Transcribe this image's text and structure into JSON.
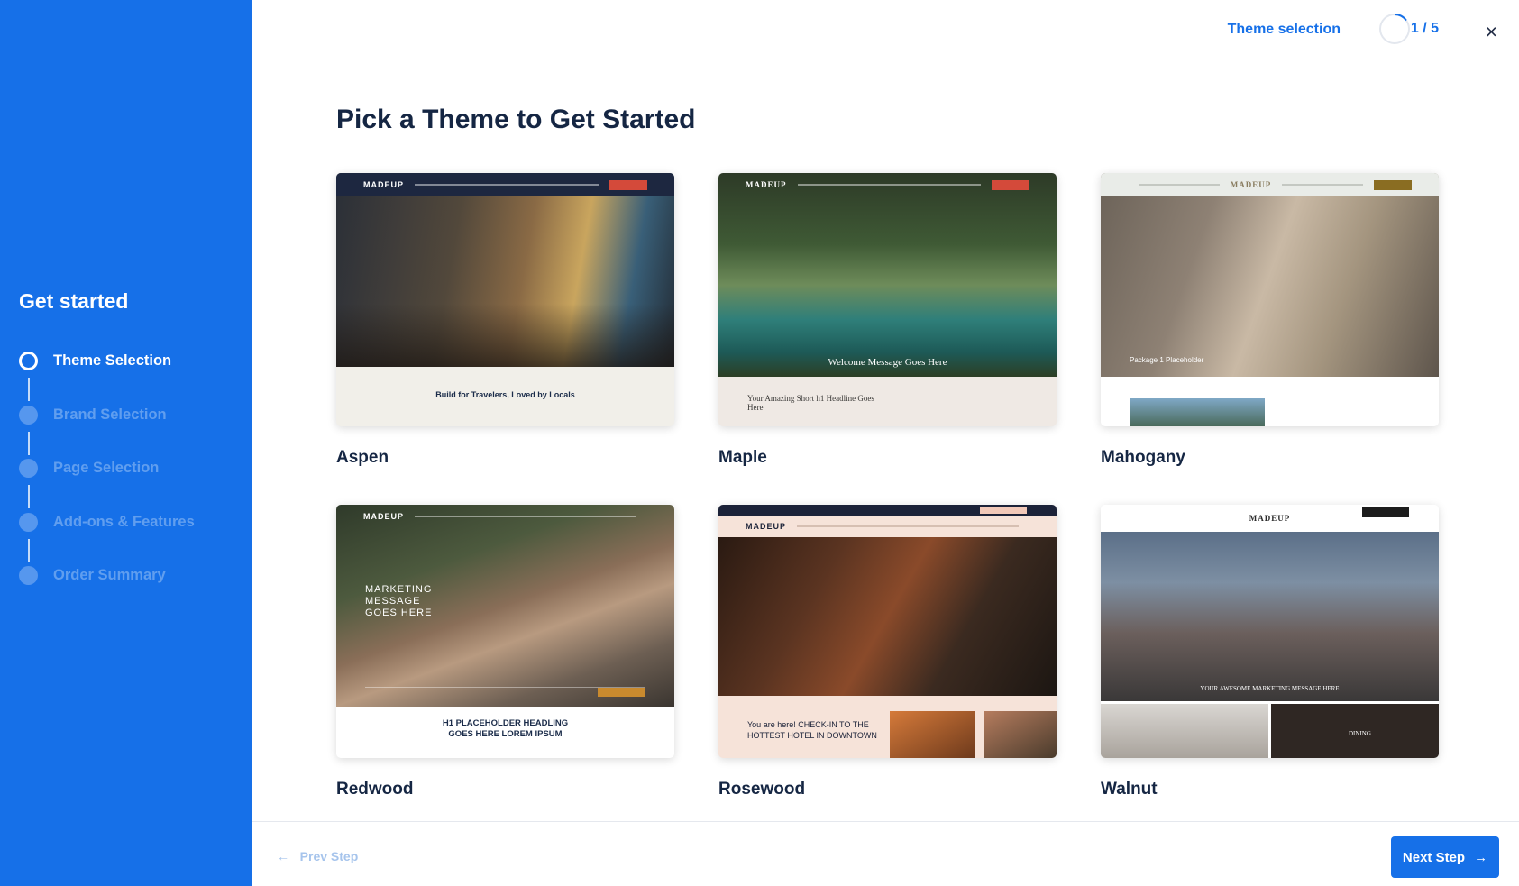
{
  "sidebar": {
    "title": "Get started",
    "steps": [
      {
        "label": "Theme Selection",
        "active": true
      },
      {
        "label": "Brand Selection",
        "active": false
      },
      {
        "label": "Page Selection",
        "active": false
      },
      {
        "label": "Add-ons & Features",
        "active": false
      },
      {
        "label": "Order Summary",
        "active": false
      }
    ]
  },
  "topbar": {
    "step_name": "Theme selection",
    "progress": "1 / 5",
    "close_icon": "×"
  },
  "main": {
    "title": "Pick a Theme to Get Started",
    "themes": [
      {
        "name": "Aspen",
        "logo": "MADEUP",
        "headline": "Build for Travelers, Loved by Locals"
      },
      {
        "name": "Maple",
        "logo": "MADEUP",
        "headline": "Welcome Message Goes Here",
        "subheadline": "Your Amazing Short h1 Headline Goes Here"
      },
      {
        "name": "Mahogany",
        "logo": "MADEUP",
        "headline": "Package 1 Placeholder"
      },
      {
        "name": "Redwood",
        "logo": "MADEUP",
        "headline": "MARKETING MESSAGE GOES HERE",
        "subheadline": "H1 PLACEHOLDER HEADLING GOES HERE LOREM IPSUM"
      },
      {
        "name": "Rosewood",
        "logo": "MADEUP",
        "headline": "You are here! CHECK-IN TO THE HOTTEST HOTEL IN DOWNTOWN"
      },
      {
        "name": "Walnut",
        "logo": "MADEUP",
        "headline": "YOUR AWESOME MARKETING MESSAGE HERE",
        "subheadline": "DINING"
      }
    ]
  },
  "footer": {
    "prev_label": "Prev Step",
    "next_label": "Next Step",
    "prev_arrow": "←",
    "next_arrow": "→"
  },
  "colors": {
    "primary": "#1670e8",
    "title": "#152643"
  }
}
